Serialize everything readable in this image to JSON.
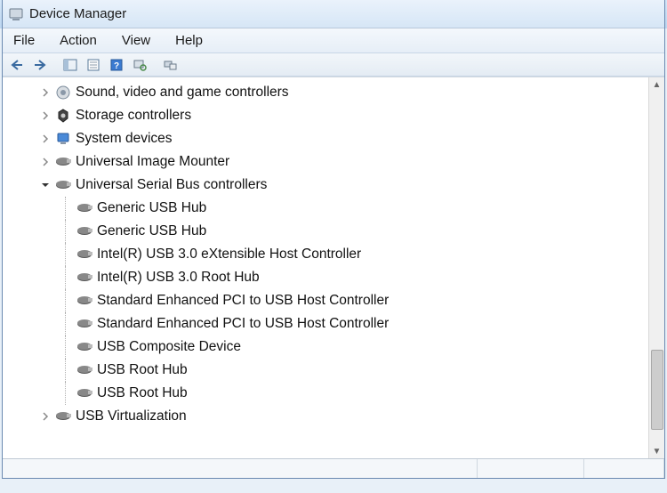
{
  "window": {
    "title": "Device Manager"
  },
  "menubar": {
    "file": "File",
    "action": "Action",
    "view": "View",
    "help": "Help"
  },
  "tree": {
    "nodes": [
      {
        "label": "Sound, video and game controllers",
        "icon": "speaker",
        "expanded": false,
        "children": []
      },
      {
        "label": "Storage controllers",
        "icon": "storage",
        "expanded": false,
        "children": []
      },
      {
        "label": "System devices",
        "icon": "system",
        "expanded": false,
        "children": []
      },
      {
        "label": "Universal Image Mounter",
        "icon": "usb",
        "expanded": false,
        "children": []
      },
      {
        "label": "Universal Serial Bus controllers",
        "icon": "usb",
        "expanded": true,
        "children": [
          {
            "label": "Generic USB Hub"
          },
          {
            "label": "Generic USB Hub"
          },
          {
            "label": "Intel(R) USB 3.0 eXtensible Host Controller"
          },
          {
            "label": "Intel(R) USB 3.0 Root Hub"
          },
          {
            "label": "Standard Enhanced PCI to USB Host Controller"
          },
          {
            "label": "Standard Enhanced PCI to USB Host Controller"
          },
          {
            "label": "USB Composite Device"
          },
          {
            "label": "USB Root Hub"
          },
          {
            "label": "USB Root Hub"
          }
        ]
      },
      {
        "label": "USB Virtualization",
        "icon": "usb",
        "expanded": false,
        "children": []
      }
    ]
  }
}
